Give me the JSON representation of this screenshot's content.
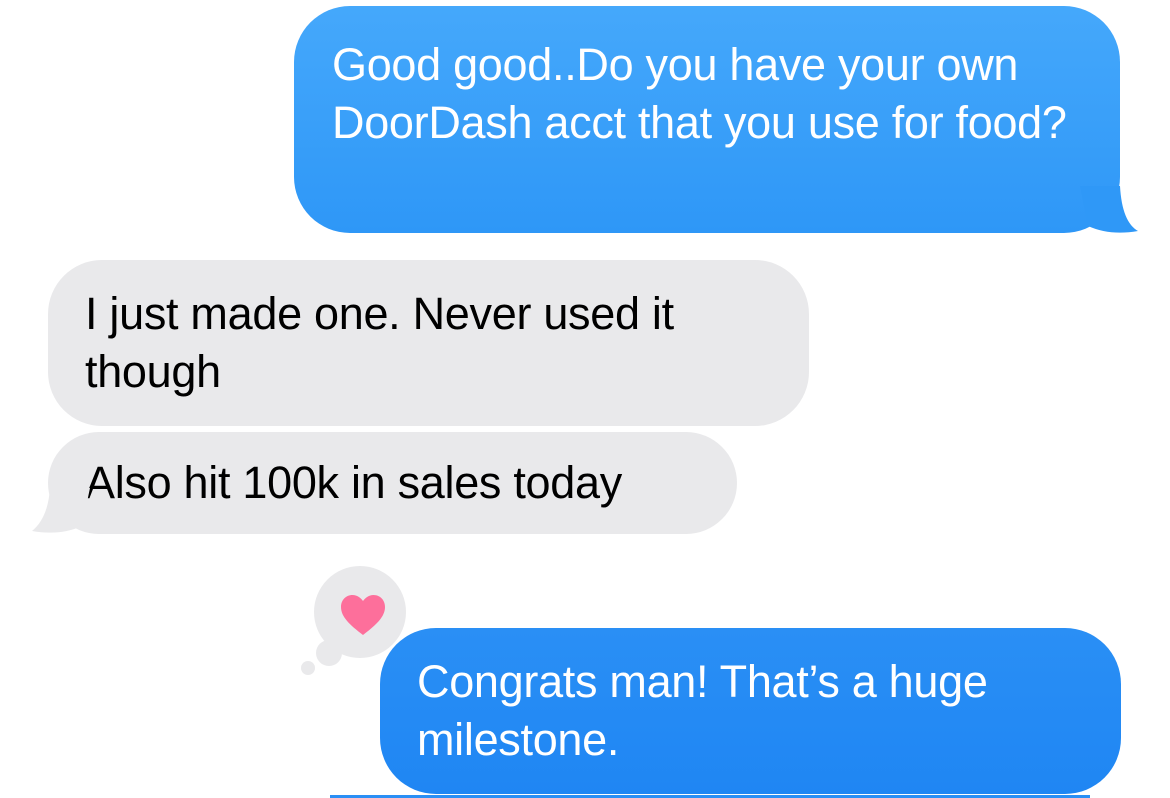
{
  "conversation": {
    "messages": [
      {
        "direction": "sent",
        "text": "Good good..Do you have your own DoorDash acct that you use for food?"
      },
      {
        "direction": "received",
        "text": "I just made one. Never used it though"
      },
      {
        "direction": "received",
        "text": "Also hit 100k in sales today"
      },
      {
        "direction": "sent",
        "text": "Congrats man! That’s a huge milestone.",
        "tapback": "heart-icon"
      }
    ]
  },
  "colors": {
    "sent_bubble": "#2e97f7",
    "received_bubble": "#e9e9eb",
    "tapback_heart": "#fd6f9b"
  }
}
